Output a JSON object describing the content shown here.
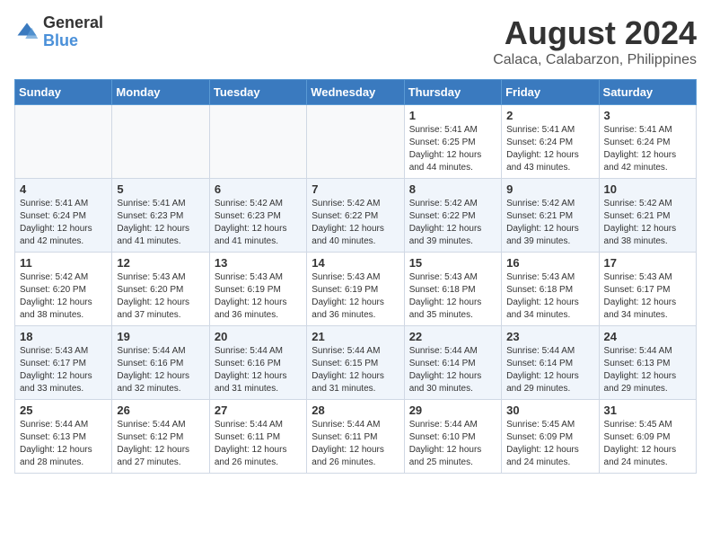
{
  "logo": {
    "general": "General",
    "blue": "Blue"
  },
  "title": "August 2024",
  "subtitle": "Calaca, Calabarzon, Philippines",
  "days_of_week": [
    "Sunday",
    "Monday",
    "Tuesday",
    "Wednesday",
    "Thursday",
    "Friday",
    "Saturday"
  ],
  "weeks": [
    [
      {
        "day": "",
        "info": ""
      },
      {
        "day": "",
        "info": ""
      },
      {
        "day": "",
        "info": ""
      },
      {
        "day": "",
        "info": ""
      },
      {
        "day": "1",
        "info": "Sunrise: 5:41 AM\nSunset: 6:25 PM\nDaylight: 12 hours\nand 44 minutes."
      },
      {
        "day": "2",
        "info": "Sunrise: 5:41 AM\nSunset: 6:24 PM\nDaylight: 12 hours\nand 43 minutes."
      },
      {
        "day": "3",
        "info": "Sunrise: 5:41 AM\nSunset: 6:24 PM\nDaylight: 12 hours\nand 42 minutes."
      }
    ],
    [
      {
        "day": "4",
        "info": "Sunrise: 5:41 AM\nSunset: 6:24 PM\nDaylight: 12 hours\nand 42 minutes."
      },
      {
        "day": "5",
        "info": "Sunrise: 5:41 AM\nSunset: 6:23 PM\nDaylight: 12 hours\nand 41 minutes."
      },
      {
        "day": "6",
        "info": "Sunrise: 5:42 AM\nSunset: 6:23 PM\nDaylight: 12 hours\nand 41 minutes."
      },
      {
        "day": "7",
        "info": "Sunrise: 5:42 AM\nSunset: 6:22 PM\nDaylight: 12 hours\nand 40 minutes."
      },
      {
        "day": "8",
        "info": "Sunrise: 5:42 AM\nSunset: 6:22 PM\nDaylight: 12 hours\nand 39 minutes."
      },
      {
        "day": "9",
        "info": "Sunrise: 5:42 AM\nSunset: 6:21 PM\nDaylight: 12 hours\nand 39 minutes."
      },
      {
        "day": "10",
        "info": "Sunrise: 5:42 AM\nSunset: 6:21 PM\nDaylight: 12 hours\nand 38 minutes."
      }
    ],
    [
      {
        "day": "11",
        "info": "Sunrise: 5:42 AM\nSunset: 6:20 PM\nDaylight: 12 hours\nand 38 minutes."
      },
      {
        "day": "12",
        "info": "Sunrise: 5:43 AM\nSunset: 6:20 PM\nDaylight: 12 hours\nand 37 minutes."
      },
      {
        "day": "13",
        "info": "Sunrise: 5:43 AM\nSunset: 6:19 PM\nDaylight: 12 hours\nand 36 minutes."
      },
      {
        "day": "14",
        "info": "Sunrise: 5:43 AM\nSunset: 6:19 PM\nDaylight: 12 hours\nand 36 minutes."
      },
      {
        "day": "15",
        "info": "Sunrise: 5:43 AM\nSunset: 6:18 PM\nDaylight: 12 hours\nand 35 minutes."
      },
      {
        "day": "16",
        "info": "Sunrise: 5:43 AM\nSunset: 6:18 PM\nDaylight: 12 hours\nand 34 minutes."
      },
      {
        "day": "17",
        "info": "Sunrise: 5:43 AM\nSunset: 6:17 PM\nDaylight: 12 hours\nand 34 minutes."
      }
    ],
    [
      {
        "day": "18",
        "info": "Sunrise: 5:43 AM\nSunset: 6:17 PM\nDaylight: 12 hours\nand 33 minutes."
      },
      {
        "day": "19",
        "info": "Sunrise: 5:44 AM\nSunset: 6:16 PM\nDaylight: 12 hours\nand 32 minutes."
      },
      {
        "day": "20",
        "info": "Sunrise: 5:44 AM\nSunset: 6:16 PM\nDaylight: 12 hours\nand 31 minutes."
      },
      {
        "day": "21",
        "info": "Sunrise: 5:44 AM\nSunset: 6:15 PM\nDaylight: 12 hours\nand 31 minutes."
      },
      {
        "day": "22",
        "info": "Sunrise: 5:44 AM\nSunset: 6:14 PM\nDaylight: 12 hours\nand 30 minutes."
      },
      {
        "day": "23",
        "info": "Sunrise: 5:44 AM\nSunset: 6:14 PM\nDaylight: 12 hours\nand 29 minutes."
      },
      {
        "day": "24",
        "info": "Sunrise: 5:44 AM\nSunset: 6:13 PM\nDaylight: 12 hours\nand 29 minutes."
      }
    ],
    [
      {
        "day": "25",
        "info": "Sunrise: 5:44 AM\nSunset: 6:13 PM\nDaylight: 12 hours\nand 28 minutes."
      },
      {
        "day": "26",
        "info": "Sunrise: 5:44 AM\nSunset: 6:12 PM\nDaylight: 12 hours\nand 27 minutes."
      },
      {
        "day": "27",
        "info": "Sunrise: 5:44 AM\nSunset: 6:11 PM\nDaylight: 12 hours\nand 26 minutes."
      },
      {
        "day": "28",
        "info": "Sunrise: 5:44 AM\nSunset: 6:11 PM\nDaylight: 12 hours\nand 26 minutes."
      },
      {
        "day": "29",
        "info": "Sunrise: 5:44 AM\nSunset: 6:10 PM\nDaylight: 12 hours\nand 25 minutes."
      },
      {
        "day": "30",
        "info": "Sunrise: 5:45 AM\nSunset: 6:09 PM\nDaylight: 12 hours\nand 24 minutes."
      },
      {
        "day": "31",
        "info": "Sunrise: 5:45 AM\nSunset: 6:09 PM\nDaylight: 12 hours\nand 24 minutes."
      }
    ]
  ]
}
